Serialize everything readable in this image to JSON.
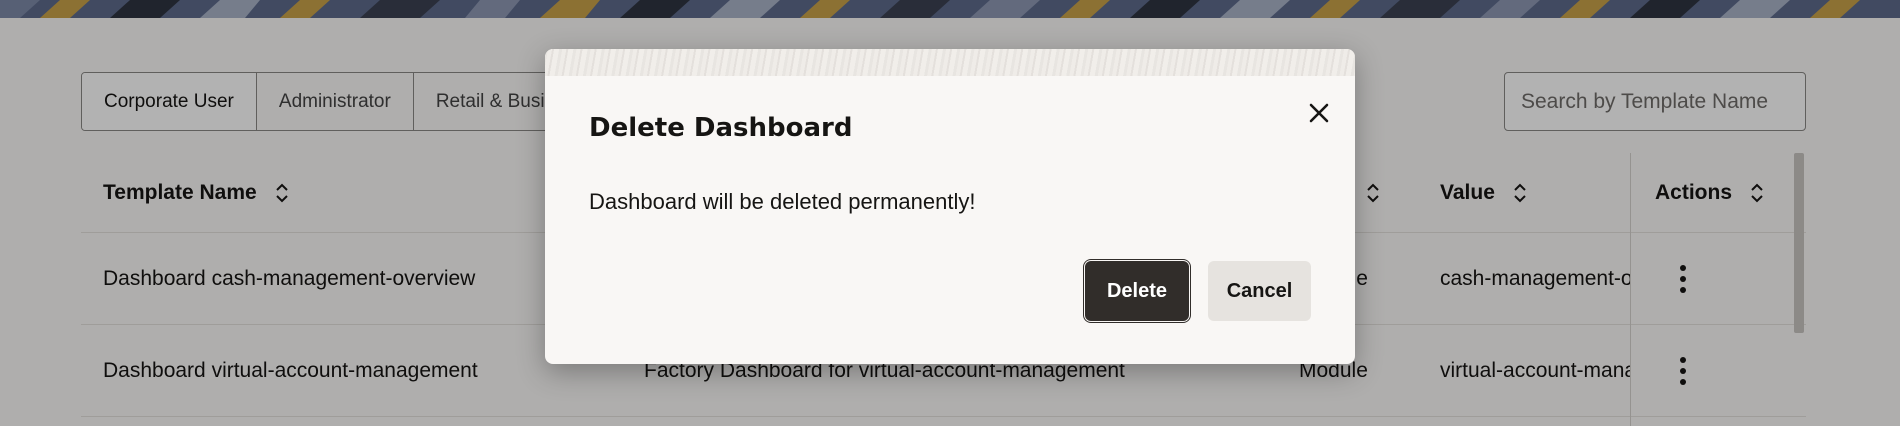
{
  "tabs": [
    {
      "label": "Corporate User",
      "active": true
    },
    {
      "label": "Administrator",
      "active": false
    },
    {
      "label": "Retail & Business",
      "active": false
    }
  ],
  "search": {
    "placeholder": "Search by Template Name"
  },
  "table": {
    "headers": {
      "template_name": "Template Name",
      "value": "Value",
      "actions": "Actions"
    },
    "rows": [
      {
        "template_name": "Dashboard cash-management-overview",
        "description": "",
        "type": "Module",
        "value": "cash-management-overview"
      },
      {
        "template_name": "Dashboard virtual-account-management",
        "description": "Factory Dashboard for virtual-account-management",
        "type": "Module",
        "value": "virtual-account-management"
      }
    ]
  },
  "dialog": {
    "title": "Delete Dashboard",
    "message": "Dashboard will be deleted permanently!",
    "delete_label": "Delete",
    "cancel_label": "Cancel"
  },
  "icons": {
    "sort": "sort-icon",
    "close": "close-icon",
    "more": "kebab-menu-icon"
  },
  "colors": {
    "primary_button": "#312d2a",
    "secondary_button": "#e6e3df",
    "banner": "#5d6b8c"
  }
}
